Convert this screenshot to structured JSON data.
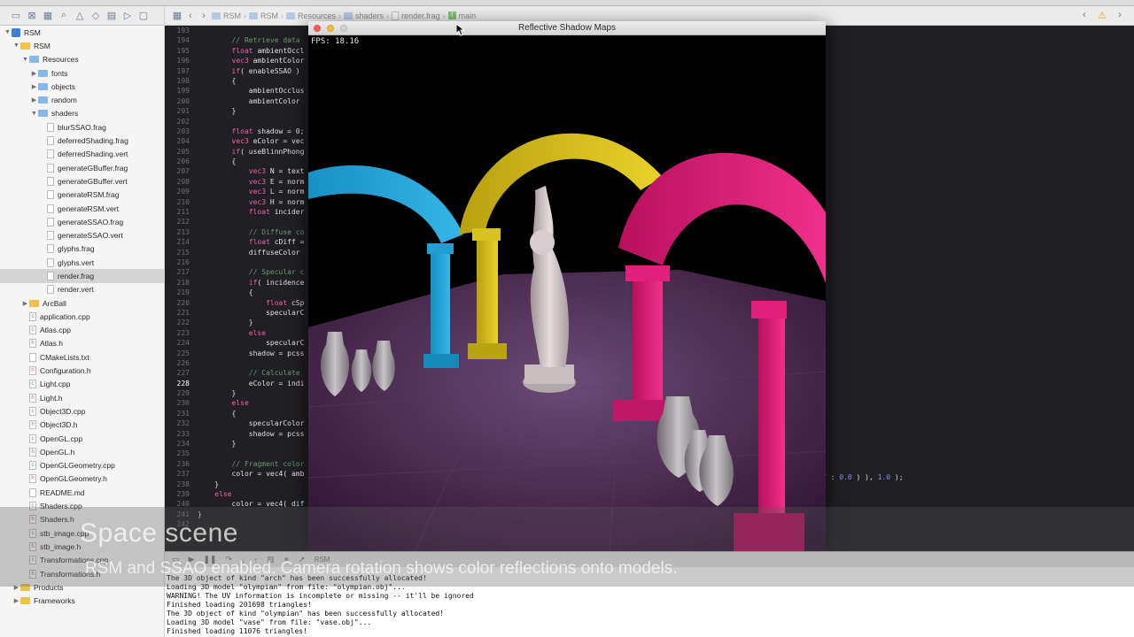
{
  "breadcrumb": [
    "RSM",
    "RSM",
    "Resources",
    "shaders",
    "render.frag",
    "main"
  ],
  "window_title": "Reflective Shadow Maps",
  "fps_label": "FPS: 18.16",
  "sidebar": {
    "items": [
      {
        "label": "RSM",
        "depth": 0,
        "kind": "project",
        "disc": "▼"
      },
      {
        "label": "RSM",
        "depth": 1,
        "kind": "folder-yellow",
        "disc": "▼"
      },
      {
        "label": "Resources",
        "depth": 2,
        "kind": "folder",
        "disc": "▼"
      },
      {
        "label": "fonts",
        "depth": 3,
        "kind": "folder",
        "disc": "▶"
      },
      {
        "label": "objects",
        "depth": 3,
        "kind": "folder",
        "disc": "▶"
      },
      {
        "label": "random",
        "depth": 3,
        "kind": "folder",
        "disc": "▶"
      },
      {
        "label": "shaders",
        "depth": 3,
        "kind": "folder",
        "disc": "▼"
      },
      {
        "label": "blurSSAO.frag",
        "depth": 4,
        "kind": "file",
        "disc": ""
      },
      {
        "label": "deferredShading.frag",
        "depth": 4,
        "kind": "file",
        "disc": ""
      },
      {
        "label": "deferredShading.vert",
        "depth": 4,
        "kind": "file",
        "disc": ""
      },
      {
        "label": "generateGBuffer.frag",
        "depth": 4,
        "kind": "file",
        "disc": ""
      },
      {
        "label": "generateGBuffer.vert",
        "depth": 4,
        "kind": "file",
        "disc": ""
      },
      {
        "label": "generateRSM.frag",
        "depth": 4,
        "kind": "file",
        "disc": ""
      },
      {
        "label": "generateRSM.vert",
        "depth": 4,
        "kind": "file",
        "disc": ""
      },
      {
        "label": "generateSSAO.frag",
        "depth": 4,
        "kind": "file",
        "disc": ""
      },
      {
        "label": "generateSSAO.vert",
        "depth": 4,
        "kind": "file",
        "disc": ""
      },
      {
        "label": "glyphs.frag",
        "depth": 4,
        "kind": "file",
        "disc": ""
      },
      {
        "label": "glyphs.vert",
        "depth": 4,
        "kind": "file",
        "disc": ""
      },
      {
        "label": "render.frag",
        "depth": 4,
        "kind": "file",
        "disc": "",
        "selected": true
      },
      {
        "label": "render.vert",
        "depth": 4,
        "kind": "file",
        "disc": ""
      },
      {
        "label": "ArcBall",
        "depth": 2,
        "kind": "folder-yellow",
        "disc": "▶"
      },
      {
        "label": "application.cpp",
        "depth": 2,
        "kind": "cpp",
        "disc": ""
      },
      {
        "label": "Atlas.cpp",
        "depth": 2,
        "kind": "cpp",
        "disc": ""
      },
      {
        "label": "Atlas.h",
        "depth": 2,
        "kind": "hdr",
        "disc": ""
      },
      {
        "label": "CMakeLists.txt",
        "depth": 2,
        "kind": "file",
        "disc": ""
      },
      {
        "label": "Configuration.h",
        "depth": 2,
        "kind": "hdr",
        "disc": ""
      },
      {
        "label": "Light.cpp",
        "depth": 2,
        "kind": "cpp",
        "disc": ""
      },
      {
        "label": "Light.h",
        "depth": 2,
        "kind": "hdr",
        "disc": ""
      },
      {
        "label": "Object3D.cpp",
        "depth": 2,
        "kind": "cpp",
        "disc": ""
      },
      {
        "label": "Object3D.h",
        "depth": 2,
        "kind": "hdr",
        "disc": ""
      },
      {
        "label": "OpenGL.cpp",
        "depth": 2,
        "kind": "cpp",
        "disc": ""
      },
      {
        "label": "OpenGL.h",
        "depth": 2,
        "kind": "hdr",
        "disc": ""
      },
      {
        "label": "OpenGLGeometry.cpp",
        "depth": 2,
        "kind": "cpp",
        "disc": ""
      },
      {
        "label": "OpenGLGeometry.h",
        "depth": 2,
        "kind": "hdr",
        "disc": ""
      },
      {
        "label": "README.md",
        "depth": 2,
        "kind": "file",
        "disc": ""
      },
      {
        "label": "Shaders.cpp",
        "depth": 2,
        "kind": "cpp",
        "disc": ""
      },
      {
        "label": "Shaders.h",
        "depth": 2,
        "kind": "hdr",
        "disc": ""
      },
      {
        "label": "stb_image.cpp",
        "depth": 2,
        "kind": "cpp",
        "disc": ""
      },
      {
        "label": "stb_image.h",
        "depth": 2,
        "kind": "hdr",
        "disc": ""
      },
      {
        "label": "Transformations.cpp",
        "depth": 2,
        "kind": "cpp",
        "disc": ""
      },
      {
        "label": "Transformations.h",
        "depth": 2,
        "kind": "hdr",
        "disc": ""
      },
      {
        "label": "Products",
        "depth": 1,
        "kind": "folder-yellow",
        "disc": "▶"
      },
      {
        "label": "Frameworks",
        "depth": 1,
        "kind": "folder-yellow",
        "disc": "▶"
      }
    ]
  },
  "editor": {
    "current_line": 228,
    "lines": [
      {
        "n": 193,
        "t": ""
      },
      {
        "n": 194,
        "t": "        // Retrieve data"
      },
      {
        "n": 195,
        "t": "        float ambientOccl"
      },
      {
        "n": 196,
        "t": "        vec3 ambientColor"
      },
      {
        "n": 197,
        "t": "        if( enableSSAO )"
      },
      {
        "n": 198,
        "t": "        {"
      },
      {
        "n": 199,
        "t": "            ambientOcclus"
      },
      {
        "n": 200,
        "t": "            ambientColor"
      },
      {
        "n": 201,
        "t": "        }"
      },
      {
        "n": 202,
        "t": ""
      },
      {
        "n": 203,
        "t": "        float shadow = 0;"
      },
      {
        "n": 204,
        "t": "        vec3 eColor = vec"
      },
      {
        "n": 205,
        "t": "        if( useBlinnPhong"
      },
      {
        "n": 206,
        "t": "        {"
      },
      {
        "n": 207,
        "t": "            vec3 N = text"
      },
      {
        "n": 208,
        "t": "            vec3 E = norm"
      },
      {
        "n": 209,
        "t": "            vec3 L = norm"
      },
      {
        "n": 210,
        "t": "            vec3 H = norm"
      },
      {
        "n": 211,
        "t": "            float incider"
      },
      {
        "n": 212,
        "t": ""
      },
      {
        "n": 213,
        "t": "            // Diffuse co"
      },
      {
        "n": 214,
        "t": "            float cDiff ="
      },
      {
        "n": 215,
        "t": "            diffuseColor"
      },
      {
        "n": 216,
        "t": ""
      },
      {
        "n": 217,
        "t": "            // Specular c"
      },
      {
        "n": 218,
        "t": "            if( incidence"
      },
      {
        "n": 219,
        "t": "            {"
      },
      {
        "n": 220,
        "t": "                float cSp"
      },
      {
        "n": 221,
        "t": "                specularC"
      },
      {
        "n": 222,
        "t": "            }"
      },
      {
        "n": 223,
        "t": "            else"
      },
      {
        "n": 224,
        "t": "                specularC"
      },
      {
        "n": 225,
        "t": "            shadow = pcss"
      },
      {
        "n": 226,
        "t": ""
      },
      {
        "n": 227,
        "t": "            // Calculate"
      },
      {
        "n": 228,
        "t": "            eColor = indi"
      },
      {
        "n": 229,
        "t": "        }"
      },
      {
        "n": 230,
        "t": "        else"
      },
      {
        "n": 231,
        "t": "        {"
      },
      {
        "n": 232,
        "t": "            specularColor"
      },
      {
        "n": 233,
        "t": "            shadow = pcss"
      },
      {
        "n": 234,
        "t": "        }"
      },
      {
        "n": 235,
        "t": ""
      },
      {
        "n": 236,
        "t": "        // Fragment color"
      },
      {
        "n": 237,
        "t": "        color = vec4( amb"
      },
      {
        "n": 238,
        "t": "    }"
      },
      {
        "n": 239,
        "t": "    else"
      },
      {
        "n": 240,
        "t": "        color = vec4( dif"
      },
      {
        "n": 241,
        "t": "}"
      },
      {
        "n": 242,
        "t": ""
      }
    ],
    "right_snippet_parts": [
      "T : ",
      "0.0",
      " ) ), ",
      "1.0",
      " );"
    ]
  },
  "console": {
    "lines": [
      "The 3D object of kind \"arch\" has been successfully allocated!",
      "Loading 3D model \"olympian\" from file: \"olympian.obj\"...",
      "WARNING! The UV information is incomplete or missing -- it'll be ignored",
      "Finished loading 201698 triangles!",
      "The 3D object of kind \"olympian\" has been successfully allocated!",
      "Loading 3D model \"vase\" from file: \"vase.obj\"...",
      "Finished loading 11076 triangles!"
    ]
  },
  "debug_target": "RSM",
  "subtitle": {
    "title": "Space scene",
    "line": "RSM and SSAO enabled. Camera rotation shows color reflections onto models."
  },
  "colors": {
    "cyan_arch": "#1ea0d2",
    "yellow_arch": "#d8c21e",
    "magenta_arch": "#e0207c",
    "floor": "#4a2a4e"
  },
  "icons": {
    "warning": "warning-icon",
    "nav_back": "chevron-left-icon",
    "nav_forward": "chevron-right-icon"
  }
}
